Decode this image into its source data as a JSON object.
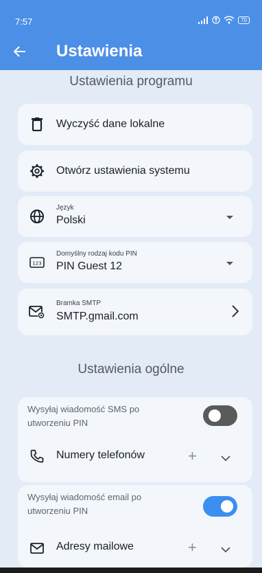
{
  "status_bar": {
    "time": "7:57",
    "battery": "70"
  },
  "app_bar": {
    "title": "Ustawienia"
  },
  "program_settings": {
    "header": "Ustawienia programu",
    "clear_data": "Wyczyść dane lokalne",
    "open_system_settings": "Otwórz ustawienia systemu",
    "language": {
      "label": "Język",
      "value": "Polski"
    },
    "pin_type": {
      "label": "Domyślny rodzaj kodu PIN",
      "value": "PIN Guest 12"
    },
    "smtp": {
      "label": "Bramka SMTP",
      "value": "SMTP.gmail.com"
    }
  },
  "general_settings": {
    "header": "Ustawienia ogólne",
    "sms": {
      "text_line1": "Wysyłaj wiadomość SMS po",
      "text_line2": "utworzeniu PIN",
      "enabled": false,
      "list_label": "Numery telefonów"
    },
    "email": {
      "text_line1": "Wysyłaj wiadomość email po",
      "text_line2": "utworzeniu PIN",
      "enabled": true,
      "list_label": "Adresy mailowe"
    }
  },
  "colors": {
    "accent": "#4c8fe6",
    "background": "#e3ebf7",
    "card": "#f3f6fb",
    "toggle_off": "#5a5a5a"
  }
}
